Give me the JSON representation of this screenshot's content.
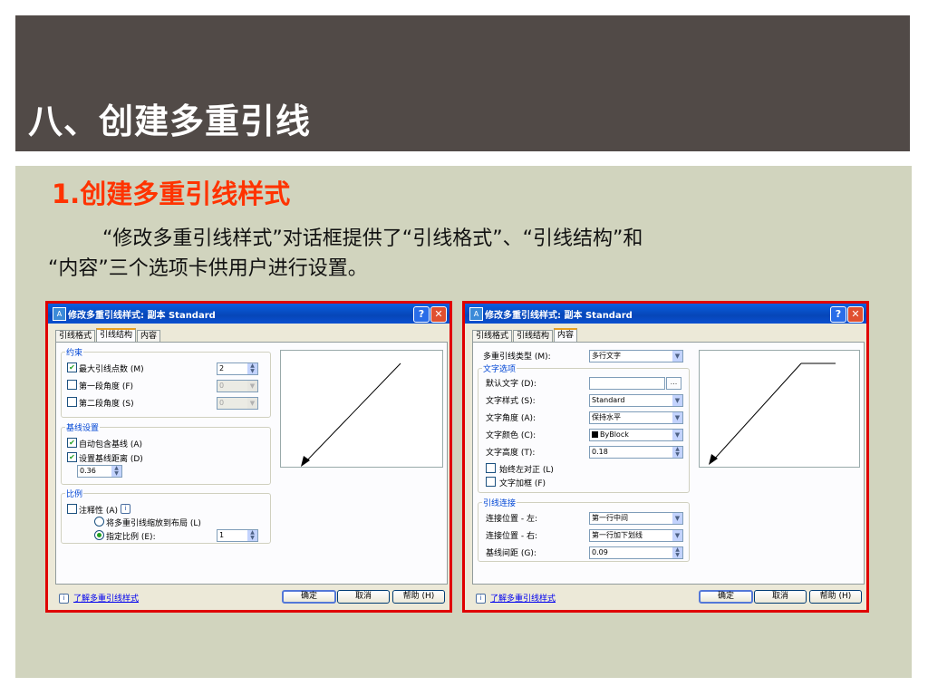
{
  "slide": {
    "title": "八、创建多重引线",
    "subtitle": "1.创建多重引线样式",
    "para_line1": "“修改多重引线样式”对话框提供了“引线格式”、“引线结构”和",
    "para_line2": "“内容”三个选项卡供用户进行设置。"
  },
  "dialog_left": {
    "title": "修改多重引线样式: 副本 Standard",
    "help_btn": "?",
    "close_btn": "✕",
    "tabs": [
      "引线格式",
      "引线结构",
      "内容"
    ],
    "active_tab": "引线结构",
    "constraints": {
      "group_title": "约束",
      "max_points_label": "最大引线点数 (M)",
      "max_points_value": "2",
      "first_angle_label": "第一段角度 (F)",
      "first_angle_value": "0",
      "second_angle_label": "第二段角度 (S)",
      "second_angle_value": "0"
    },
    "landing": {
      "group_title": "基线设置",
      "auto_include_label": "自动包含基线 (A)",
      "set_distance_label": "设置基线距离 (D)",
      "distance_value": "0.36"
    },
    "scale": {
      "group_title": "比例",
      "annotative_label": "注释性 (A)",
      "to_layout_label": "将多重引线缩放到布局 (L)",
      "specify_label": "指定比例 (E):",
      "specify_value": "1"
    },
    "footer_link": "了解多重引线样式",
    "ok_label": "确定",
    "cancel_label": "取消",
    "help_label": "帮助 (H)"
  },
  "dialog_right": {
    "title": "修改多重引线样式: 副本 Standard",
    "help_btn": "?",
    "close_btn": "✕",
    "tabs": [
      "引线格式",
      "引线结构",
      "内容"
    ],
    "active_tab": "内容",
    "mleader_type_label": "多重引线类型 (M):",
    "mleader_type_value": "多行文字",
    "text_options": {
      "group_title": "文字选项",
      "default_text_label": "默认文字 (D):",
      "default_text_value": "",
      "browse_label": "...",
      "text_style_label": "文字样式 (S):",
      "text_style_value": "Standard",
      "text_angle_label": "文字角度 (A):",
      "text_angle_value": "保持水平",
      "text_color_label": "文字颜色 (C):",
      "text_color_value": "ByBlock",
      "text_height_label": "文字高度 (T):",
      "text_height_value": "0.18",
      "always_left_label": "始终左对正 (L)",
      "text_frame_label": "文字加框 (F)"
    },
    "leader_connection": {
      "group_title": "引线连接",
      "attach_left_label": "连接位置 - 左:",
      "attach_left_value": "第一行中间",
      "attach_right_label": "连接位置 - 右:",
      "attach_right_value": "第一行加下划线",
      "landing_gap_label": "基线间距 (G):",
      "landing_gap_value": "0.09"
    },
    "footer_link": "了解多重引线样式",
    "ok_label": "确定",
    "cancel_label": "取消",
    "help_label": "帮助 (H)"
  },
  "colors": {
    "header_bg": "#514a47",
    "content_bg": "#d1d4be",
    "subtitle": "#ff3300",
    "frame_border": "#e00000",
    "xp_title": "#0a5fe0"
  },
  "icons": {
    "app": "autocad-app-icon",
    "info": "info-icon",
    "dropdown": "chevron-down-icon",
    "spinner": "spinner-arrows-icon"
  }
}
